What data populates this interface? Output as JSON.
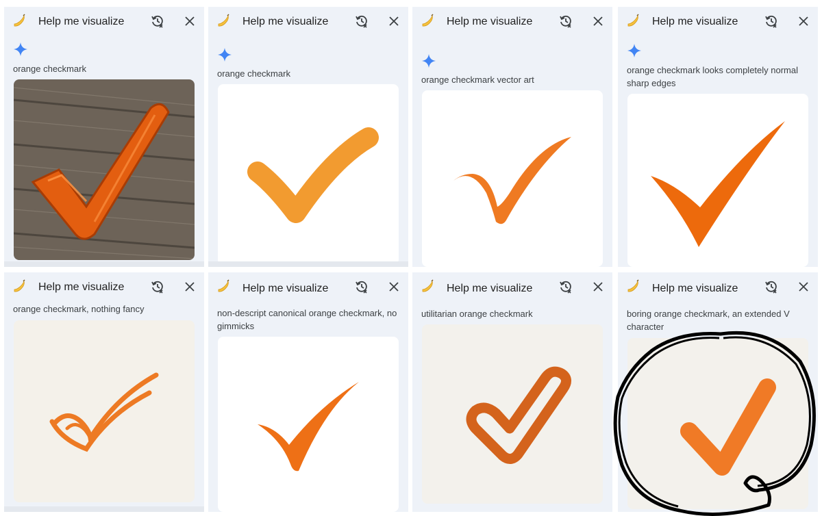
{
  "panels": [
    {
      "title": "Help me visualize",
      "prompt": "orange checkmark"
    },
    {
      "title": "Help me visualize",
      "prompt": "orange checkmark"
    },
    {
      "title": "Help me visualize",
      "prompt": "orange checkmark vector art"
    },
    {
      "title": "Help me visualize",
      "prompt": "orange checkmark looks completely normal sharp edges"
    },
    {
      "title": "Help me visualize",
      "prompt": "orange checkmark, nothing fancy"
    },
    {
      "title": "Help me visualize",
      "prompt": "non-descript canonical orange checkmark, no gimmicks"
    },
    {
      "title": "Help me visualize",
      "prompt": "utilitarian orange checkmark"
    },
    {
      "title": "Help me visualize",
      "prompt": "boring orange checkmark, an extended V character"
    }
  ],
  "icons": {
    "header_left": "banana-icon",
    "history": "history-icon",
    "close": "close-icon",
    "assistant": "sparkle-icon"
  },
  "colors": {
    "panel_bg": "#eef2f8",
    "sparkle": "#4285f4",
    "orange": "#f07a1e",
    "scribble": "#000000"
  }
}
